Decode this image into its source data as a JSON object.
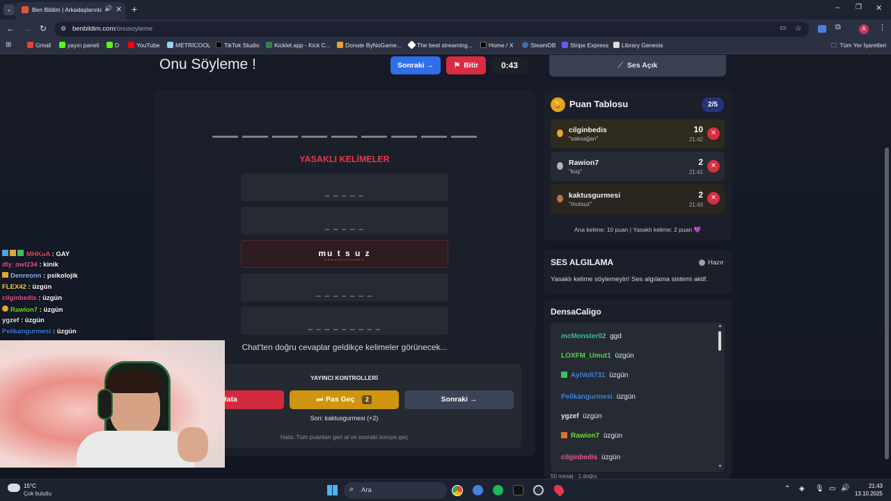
{
  "browser": {
    "tab_title": "Ben Bildim | Arkadaşlarınla ",
    "url_host": "benbildim.com",
    "url_path": "/onusoyleme",
    "bookmarks": [
      "Gmail",
      "yayın paneli",
      "D",
      "YouTube",
      "METRİCOOL",
      "TikTok Studio",
      "Kicklet.app - Kick C...",
      "Donate ByNoGame...",
      "The best streaming...",
      "Home / X",
      "SteamDB",
      "Stripe Express",
      "Library Genesis"
    ],
    "all_bookmarks": "Tüm Yer İşaretleri",
    "profile_letter": "A"
  },
  "game": {
    "title": "Onu Söyleme !",
    "next_label": "Sonraki →",
    "finish_label": "Bitir",
    "timer": "0:43",
    "forbidden_title": "YASAKLI KELİMELER",
    "slots": [
      "_ _ _ _ _",
      "_ _ _ _ _",
      "mu t s u z",
      "_ _ _ _ _ _ _",
      "_ _ _ _ _ _ _ _ _"
    ],
    "hint": "Chat'ten doğru cevaplar geldikçe kelimeler görünecek...",
    "controls_title": "YAYINCI KONTROLLERİ",
    "error_label": "Hata",
    "pass_label": "Pas Geç",
    "pass_count": "2",
    "next2_label": "Sonraki →",
    "last": "Son: kaktusgurmesi (+2)",
    "error_hint": "Hata: Tüm puanları geri al ve sonraki soruya geç"
  },
  "sound": {
    "label": "Ses Açık"
  },
  "leaderboard": {
    "title": "Puan Tablosu",
    "page": "2/5",
    "entries": [
      {
        "name": "cilginbedis",
        "word": "\"saksağan\"",
        "score": "10",
        "time": "21:42",
        "bg": "#2e2a1c",
        "medal": "#e0a82e"
      },
      {
        "name": "Rawion7",
        "word": "\"kuş\"",
        "score": "2",
        "time": "21:41",
        "bg": "#262a33",
        "medal": "#aab4c6"
      },
      {
        "name": "kaktusgurmesi",
        "word": "\"mutsuz\"",
        "score": "2",
        "time": "21:43",
        "bg": "#2b2520",
        "medal": "#b8774a"
      }
    ],
    "footer": "Ana kelime: 10 puan | Yasaklı kelime: 2 puan 💜"
  },
  "voice": {
    "title": "SES ALGILAMA",
    "status": "Hazır",
    "desc": "Yasaklı kelime söylemeyin! Ses algılama sistemi aktif."
  },
  "chat": {
    "channel": "DensaCaligo",
    "messages": [
      {
        "user": "mcMonster02",
        "text": "ggd",
        "color": "#3dbd8a"
      },
      {
        "user": "LOXFM_Umut1",
        "text": "üzgün",
        "color": "#4fd14a"
      },
      {
        "user": "AyiVoli731",
        "text": "üzgün",
        "color": "#3f7fd8"
      },
      {
        "user": "Pelikangurmesi",
        "text": "üzgün",
        "color": "#3f7fd8"
      },
      {
        "user": "ygzef",
        "text": "üzgün",
        "color": "#e6e6e6"
      },
      {
        "user": "Rawion7",
        "text": "üzgün",
        "color": "#6fdc3a"
      },
      {
        "user": "cilginbedis",
        "text": "üzgün",
        "color": "#e45a8a"
      }
    ],
    "footer": "50 mesaj · 1 doğru"
  },
  "overlay_chat": [
    {
      "user": "MHKuA",
      "text": "GAY",
      "color": "#e84b6a"
    },
    {
      "user": "dly_owl234",
      "text": "kinik",
      "color": "#e45a8a"
    },
    {
      "user": "Denreonn",
      "text": "psikolojik",
      "color": "#8fb6ff"
    },
    {
      "user": "FLEX42",
      "text": "üzgün",
      "color": "#f5d33c"
    },
    {
      "user": "cilginbedis",
      "text": "üzgün",
      "color": "#e45a8a"
    },
    {
      "user": "Rawion7",
      "text": "üzgün",
      "color": "#6fdc3a"
    },
    {
      "user": "ygzef",
      "text": "üzgün",
      "color": "#e6e6e6"
    },
    {
      "user": "Pelikangurmesi",
      "text": "üzgün",
      "color": "#3f7fd8"
    }
  ],
  "taskbar": {
    "temp": "15°C",
    "weather": "Çok bulutlu",
    "search": "Ara",
    "time": "21:43",
    "date": "13.10.2025"
  }
}
